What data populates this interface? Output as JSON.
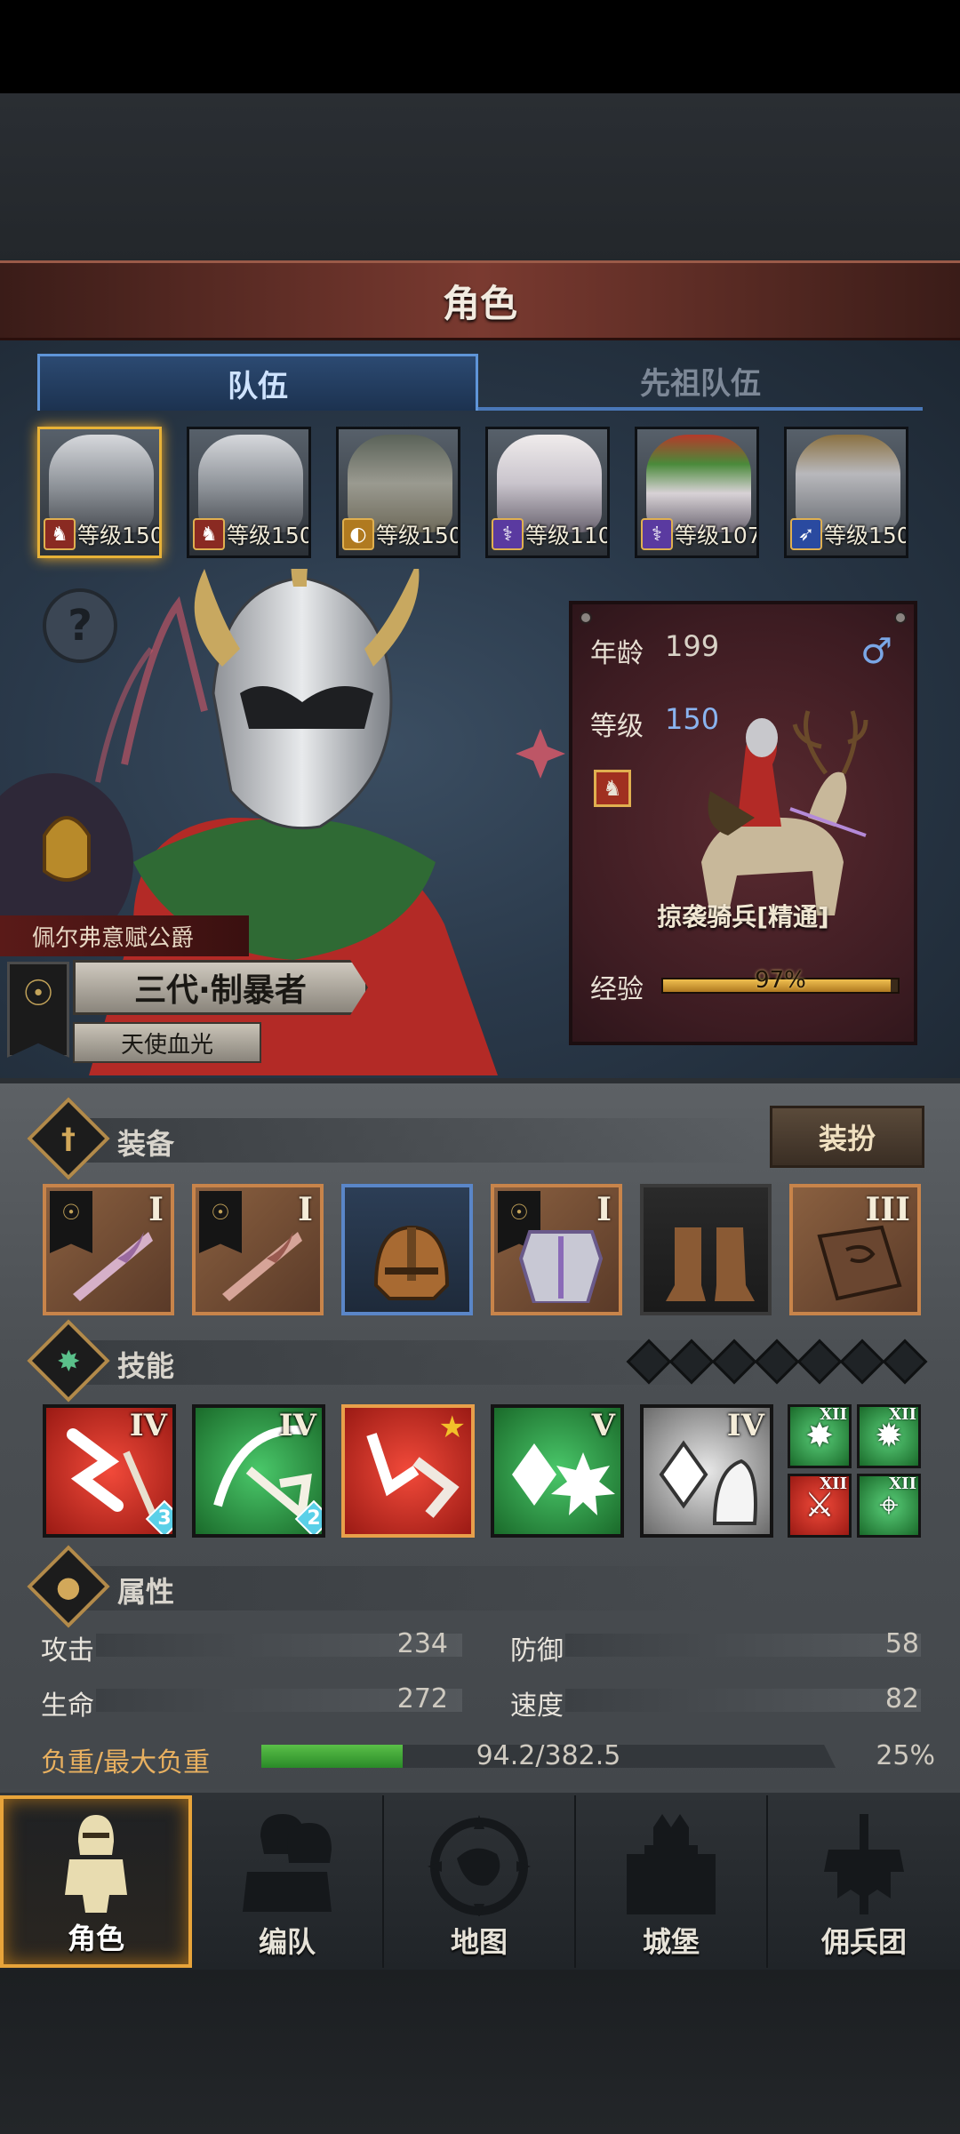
{
  "header": {
    "title": "角色"
  },
  "tabs": [
    {
      "label": "队伍",
      "active": true
    },
    {
      "label": "先祖队伍",
      "active": false
    }
  ],
  "roster": [
    {
      "level_label": "等级150",
      "class_icon": "cavalry-icon",
      "badge_color": "red",
      "selected": true
    },
    {
      "level_label": "等级150",
      "class_icon": "cavalry-icon",
      "badge_color": "red",
      "selected": false
    },
    {
      "level_label": "等级150",
      "class_icon": "shield-icon",
      "badge_color": "gold",
      "selected": false
    },
    {
      "level_label": "等级110",
      "class_icon": "staff-icon",
      "badge_color": "purple",
      "selected": false
    },
    {
      "level_label": "等级107",
      "class_icon": "staff-icon",
      "badge_color": "purple",
      "selected": false
    },
    {
      "level_label": "等级150",
      "class_icon": "crossbow-icon",
      "badge_color": "blue",
      "selected": false
    }
  ],
  "hero": {
    "title_ribbon": "佩尔弗意赋公爵",
    "name": "三代·制暴者",
    "subtitle": "天使血光",
    "age_label": "年龄",
    "age_value": "199",
    "gender": "♂",
    "level_label": "等级",
    "level_value": "150",
    "unit_name": "掠袭骑兵[精通]",
    "exp_label": "经验",
    "exp_percent_text": "97%",
    "exp_fraction": 0.97
  },
  "equipment": {
    "section_title": "装备",
    "dress_button": "装扮",
    "items": [
      {
        "name": "weapon-slot-1",
        "tier": "I",
        "style": "orange",
        "flag": true
      },
      {
        "name": "weapon-slot-2",
        "tier": "I",
        "style": "orange",
        "flag": true
      },
      {
        "name": "helmet-slot",
        "tier": "",
        "style": "blue",
        "flag": false
      },
      {
        "name": "armor-slot",
        "tier": "I",
        "style": "orange",
        "flag": true
      },
      {
        "name": "boots-slot",
        "tier": "",
        "style": "dark",
        "flag": false
      },
      {
        "name": "book-slot",
        "tier": "III",
        "style": "orange",
        "flag": false
      }
    ]
  },
  "skills": {
    "section_title": "技能",
    "slots": [
      {
        "tier": "IV",
        "color": "red",
        "count": "3"
      },
      {
        "tier": "IV",
        "color": "green",
        "count": "2"
      },
      {
        "tier": "",
        "color": "red",
        "count": "",
        "star": true
      },
      {
        "tier": "V",
        "color": "green",
        "count": ""
      },
      {
        "tier": "IV",
        "color": "gray",
        "count": ""
      }
    ],
    "passives": [
      {
        "tier": "XII",
        "color": "green",
        "glyph": "✸"
      },
      {
        "tier": "XII",
        "color": "green",
        "glyph": "✹"
      },
      {
        "tier": "XII",
        "color": "red",
        "glyph": "⚔"
      },
      {
        "tier": "XII",
        "color": "green",
        "glyph": "⌖"
      }
    ]
  },
  "attributes": {
    "section_title": "属性",
    "attack_label": "攻击",
    "attack_value": "234",
    "defense_label": "防御",
    "defense_value": "58",
    "hp_label": "生命",
    "hp_value": "272",
    "speed_label": "速度",
    "speed_value": "82",
    "load_label": "负重/最大负重",
    "load_text": "94.2/382.5",
    "load_percent_text": "25%",
    "load_fraction": 0.246
  },
  "nav": [
    {
      "label": "角色",
      "active": true
    },
    {
      "label": "编队",
      "active": false
    },
    {
      "label": "地图",
      "active": false
    },
    {
      "label": "城堡",
      "active": false
    },
    {
      "label": "佣兵团",
      "active": false
    }
  ],
  "colors": {
    "accent_gold": "#e8a43a",
    "tab_blue": "#5f95d8",
    "load_green": "#3aa838"
  }
}
